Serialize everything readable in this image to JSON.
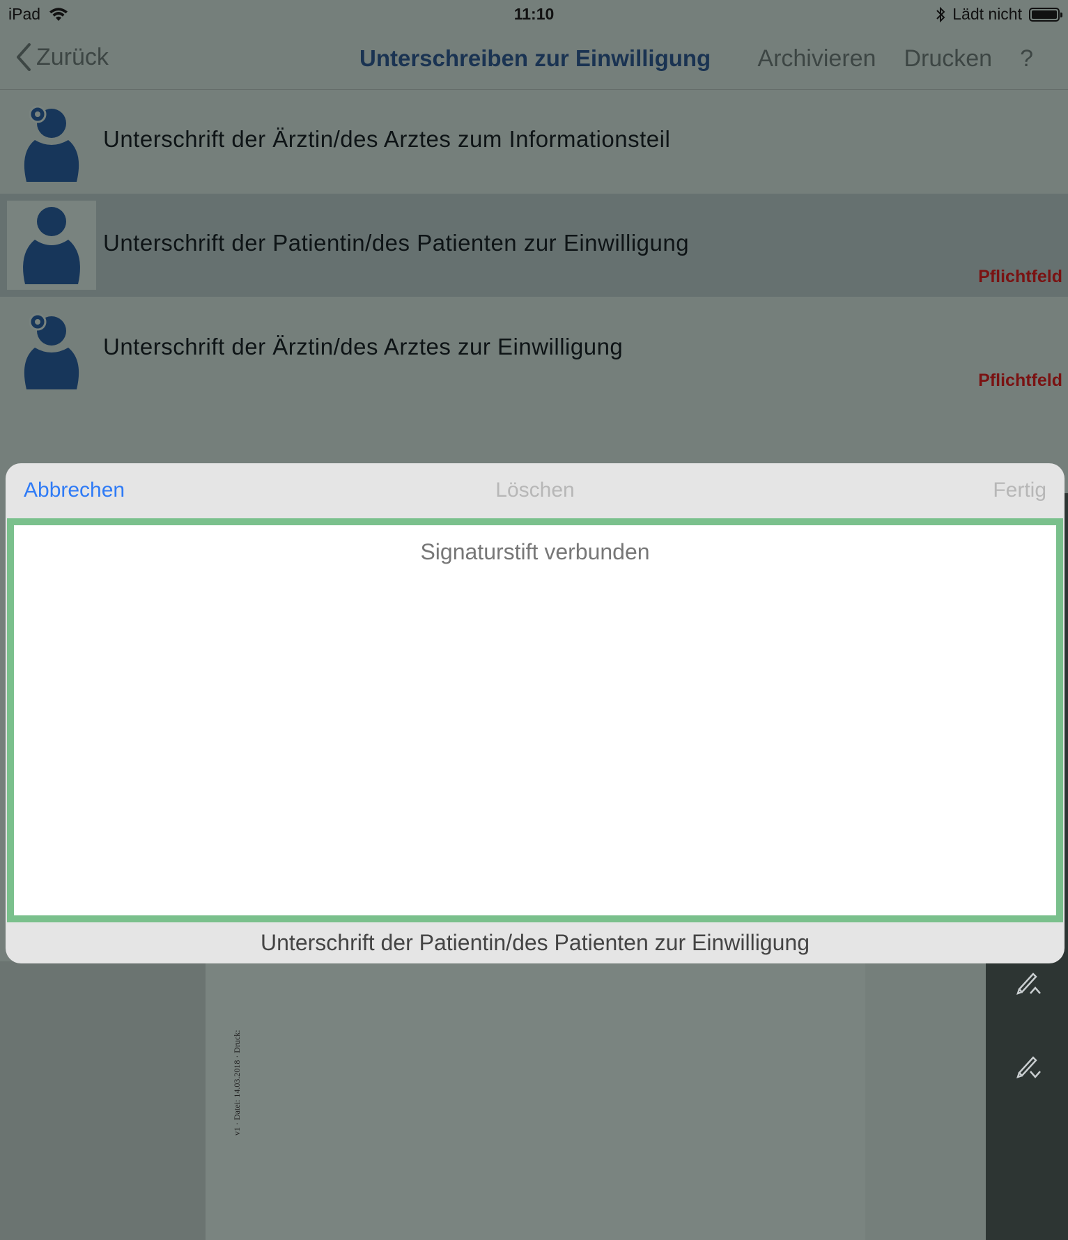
{
  "status_bar": {
    "device": "iPad",
    "time": "11:10",
    "charging": "Lädt nicht",
    "icons": [
      "wifi-icon",
      "bluetooth-icon",
      "battery-icon"
    ]
  },
  "nav": {
    "back_label": "Zurück",
    "title": "Unterschreiben zur Einwilligung",
    "archive_label": "Archivieren",
    "print_label": "Drucken",
    "help_label": "?"
  },
  "signature_list": [
    {
      "label": "Unterschrift der Ärztin/des Arztes zum Informationsteil",
      "badge": "",
      "avatar": "doctor-avatar-icon",
      "selected": false
    },
    {
      "label": "Unterschrift der Patientin/des Patienten zur Einwilligung",
      "badge": "Pflichtfeld",
      "avatar": "patient-avatar-icon",
      "selected": true
    },
    {
      "label": "Unterschrift der Ärztin/des Arztes zur Einwilligung",
      "badge": "Pflichtfeld",
      "avatar": "doctor-avatar-icon",
      "selected": false
    }
  ],
  "modal": {
    "cancel_label": "Abbrechen",
    "clear_label": "Löschen",
    "done_label": "Fertig",
    "status_text": "Signaturstift verbunden",
    "caption": "Unterschrift der Patientin/des Patienten zur Einwilligung"
  },
  "document": {
    "footer_text": "v1 · Datei: 14.03.2018 · Druck:"
  },
  "tools": [
    "pen-up-icon",
    "pen-down-icon"
  ],
  "colors": {
    "accent": "#2f7bf6",
    "title": "#1a3352",
    "required": "#7a1212",
    "signature_border": "#7ac08c",
    "avatar": "#17365a"
  }
}
